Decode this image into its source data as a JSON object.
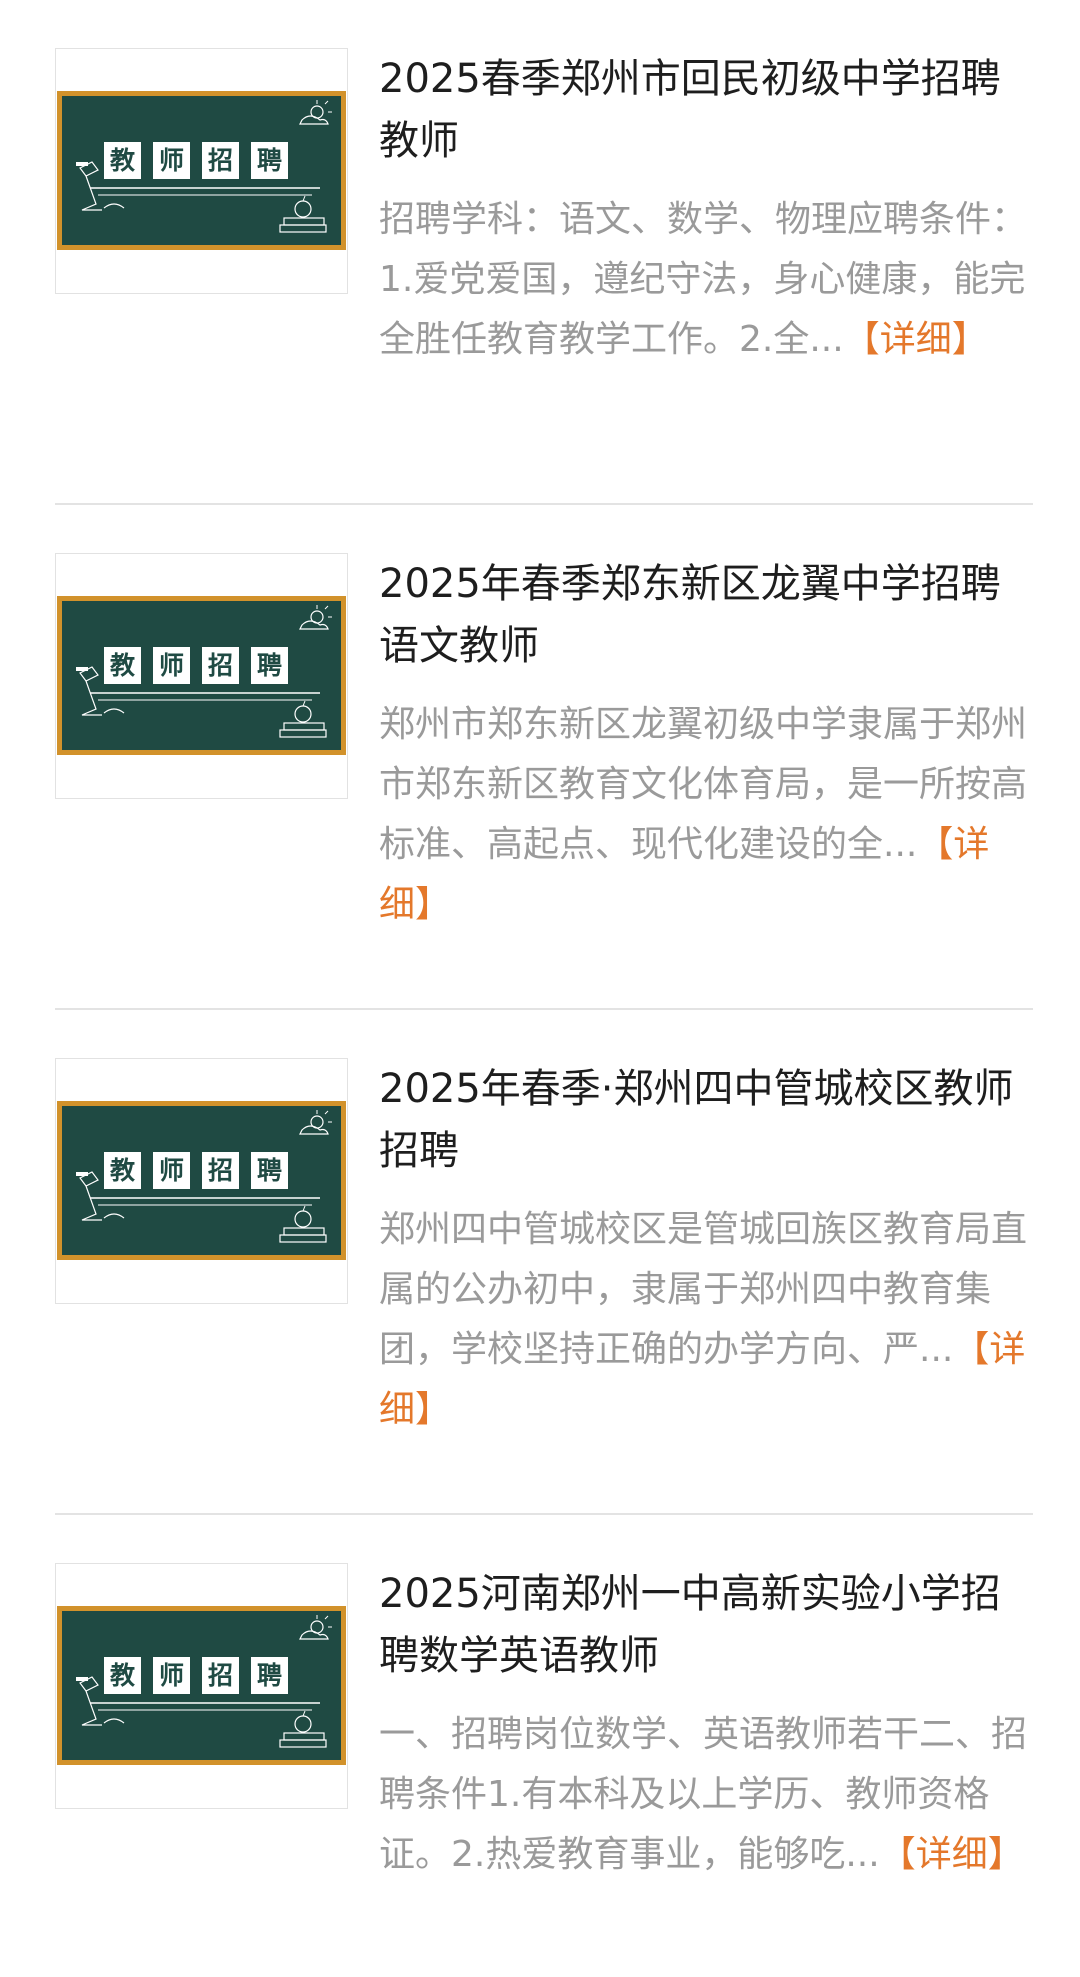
{
  "thumbnail": {
    "board_chars": [
      "教",
      "师",
      "招",
      "聘"
    ]
  },
  "items": [
    {
      "title": "2025春季郑州市回民初级中学招聘教师",
      "summary": "招聘学科：语文、数学、物理应聘条件：1.爱党爱国，遵纪守法，身心健康，能完全胜任教育教学工作。2.全...",
      "more_label": "【详细】"
    },
    {
      "title": "2025年春季郑东新区龙翼中学招聘语文教师",
      "summary": "郑州市郑东新区龙翼初级中学隶属于郑州市郑东新区教育文化体育局，是一所按高标准、高起点、现代化建设的全...",
      "more_label": "【详细】"
    },
    {
      "title": "2025年春季·郑州四中管城校区教师招聘",
      "summary": "郑州四中管城校区是管城回族区教育局直属的公办初中，隶属于郑州四中教育集团，学校坚持正确的办学方向、严...",
      "more_label": "【详细】"
    },
    {
      "title": "2025河南郑州一中高新实验小学招聘数学英语教师",
      "summary": "一、招聘岗位数学、英语教师若干二、招聘条件1.有本科及以上学历、教师资格证。2.热爱教育事业，能够吃...",
      "more_label": "【详细】"
    }
  ],
  "colors": {
    "board": "#1f4a43",
    "board_frame": "#d2922b",
    "link_accent": "#e4782b",
    "summary_text": "#9a9a9a"
  },
  "icons": [
    "blackboard-thumbnail",
    "sun-doodle-icon",
    "lamp-doodle-icon",
    "books-apple-doodle-icon"
  ]
}
